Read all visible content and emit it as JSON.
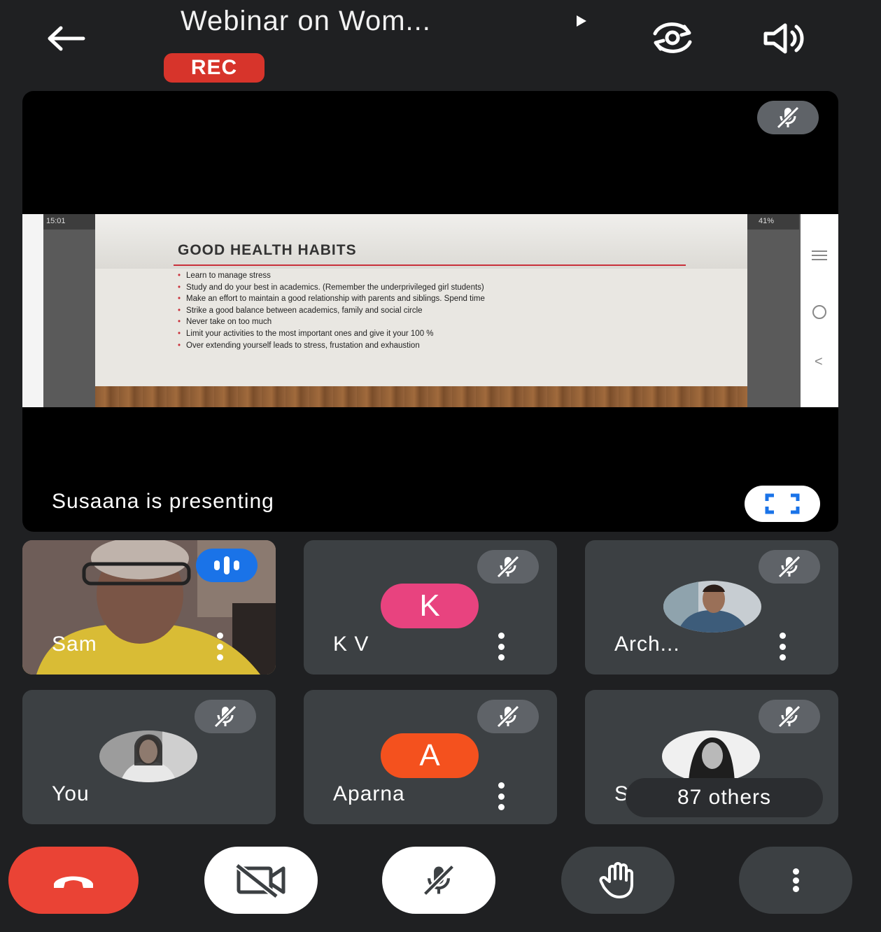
{
  "header": {
    "title": "Webinar on Wom...",
    "rec_label": "REC"
  },
  "presentation": {
    "presenting_label": "Susaana is presenting",
    "screen_time": "15:01",
    "screen_battery": "41%",
    "slide_title": "GOOD HEALTH HABITS",
    "slide_bullets": [
      "Learn to manage stress",
      "Study and do your best in academics. (Remember the underprivileged girl students)",
      "Make an effort to maintain a good relationship with parents and siblings. Spend time",
      "Strike a good balance between academics, family and social circle",
      "Never take on too much",
      "Limit your activities to the most important ones and give it your 100 %",
      "Over extending yourself leads to stress, frustation and exhaustion"
    ]
  },
  "participants": [
    {
      "name": "Sam",
      "type": "video",
      "muted": false,
      "speaking": true
    },
    {
      "name": "K V",
      "type": "letter",
      "letter": "K",
      "avatar_color": "#e8437f",
      "muted": true
    },
    {
      "name": "Arch...",
      "type": "photo",
      "muted": true
    },
    {
      "name": "You",
      "type": "photo",
      "muted": true
    },
    {
      "name": "Aparna",
      "type": "letter",
      "letter": "A",
      "avatar_color": "#f4511e",
      "muted": true
    },
    {
      "name": "Se",
      "type": "photo",
      "muted": true,
      "others_label": "87 others"
    }
  ],
  "colors": {
    "background": "#1f2022",
    "tile": "#3c4043",
    "end_call": "#ea4335",
    "rec": "#d7342b",
    "speaking": "#1a73e8"
  },
  "controls": [
    {
      "name": "end-call",
      "icon": "phone-hangup-icon"
    },
    {
      "name": "camera",
      "icon": "camera-off-icon",
      "state": "off"
    },
    {
      "name": "microphone",
      "icon": "mic-off-icon",
      "state": "off"
    },
    {
      "name": "raise-hand",
      "icon": "hand-icon"
    },
    {
      "name": "more-options",
      "icon": "more-vertical-icon"
    }
  ]
}
